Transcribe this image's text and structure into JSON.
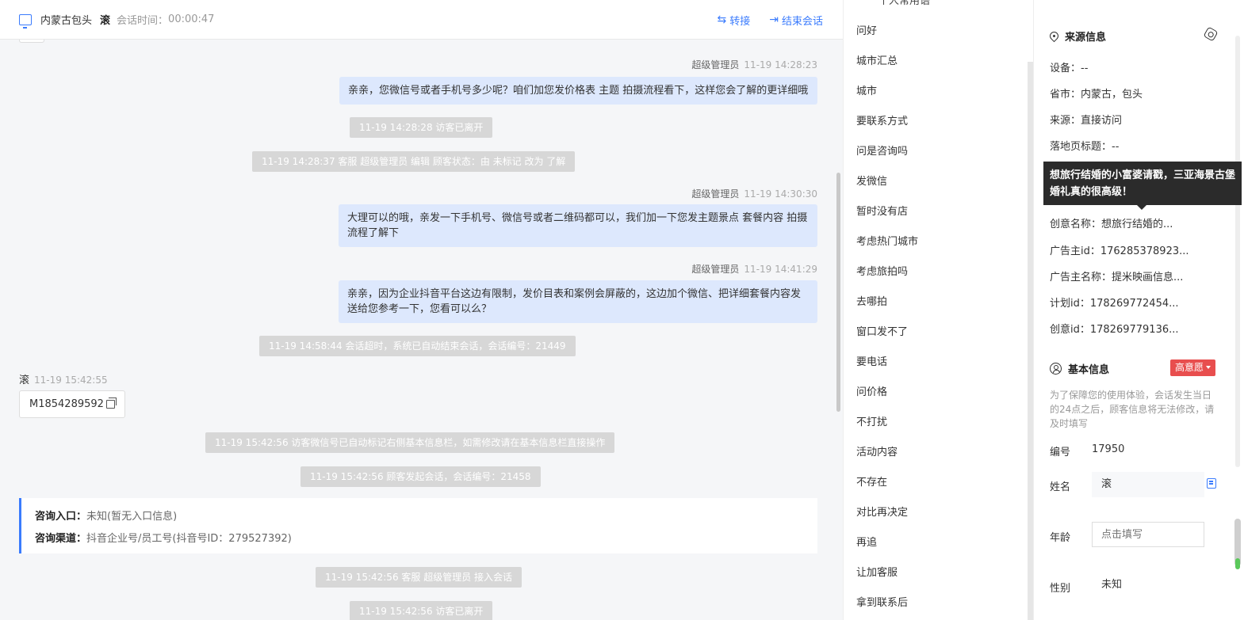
{
  "header": {
    "location": "内蒙古包头",
    "visitor_name": "滚",
    "session_time_label": "会话时间：",
    "session_time": "00:00:47",
    "transfer_label": "转接",
    "end_label": "结束会话"
  },
  "messages": {
    "m1": {
      "sender": "超级管理员",
      "time": "11-19 14:28:23",
      "text": "亲亲，您微信号或者手机号多少呢？咱们加您发价格表 主题 拍摄流程看下，这样您会了解的更详细哦"
    },
    "s1": "11-19 14:28:28 访客已离开",
    "s2": "11-19 14:28:37 客服 超级管理员 编辑 顾客状态：由 未标记 改为 了解",
    "m2": {
      "sender": "超级管理员",
      "time": "11-19 14:30:30",
      "line1": "大理可以的哦，亲发一下手机号、微信号或者二维码都可以，我们加一下您发主题景点 套餐内容 拍摄",
      "line2": "流程了解下"
    },
    "m3": {
      "sender": "超级管理员",
      "time": "11-19 14:41:29",
      "line1": "亲亲，因为企业抖音平台这边有限制，发价目表和案例会屏蔽的，这边加个微信、把详细套餐内容发",
      "line2": "送给您参考一下，您看可以么？"
    },
    "s3": "11-19 14:58:44 会话超时，系统已自动结束会话，会话编号：21449",
    "m4": {
      "sender": "滚",
      "time": "11-19 15:42:55",
      "text": "M1854289592"
    },
    "s4": "11-19 15:42:56 访客微信号已自动标记右侧基本信息栏，如需修改请在基本信息栏直接操作",
    "s5": "11-19 15:42:56 顾客发起会话，会话编号：21458",
    "entry": {
      "entry_label": "咨询入口：",
      "entry_value": "未知(暂无入口信息)",
      "channel_label": "咨询渠道：",
      "channel_value": "抖音企业号/员工号(抖音号ID：279527392)"
    },
    "s6": "11-19 15:42:56 客服 超级管理员 接入会话",
    "s7": "11-19 15:42:56 访客已离开"
  },
  "quick_replies": {
    "partial_top": "个人常用语",
    "items": [
      "问好",
      "城市汇总",
      "城市",
      "要联系方式",
      "问是咨询吗",
      "发微信",
      "暂时没有店",
      "考虑热门城市",
      "考虑旅拍吗",
      "去哪拍",
      "窗口发不了",
      "要电话",
      "问价格",
      "不打扰",
      "活动内容",
      "不存在",
      "对比再决定",
      "再追",
      "让加客服",
      "拿到联系后"
    ]
  },
  "source_info": {
    "title": "来源信息",
    "rows": {
      "device": "设备：--",
      "province": "省市：内蒙古，包头",
      "source": "来源：直接访问",
      "landing_title": "落地页标题：--",
      "creative_name": "创意名称：想旅行结婚的...",
      "advertiser_id": "广告主id：176285378923...",
      "advertiser_name": "广告主名称：提米映画信息...",
      "plan_id": "计划id：178269772454...",
      "creative_id": "创意id：178269779136..."
    },
    "tooltip": "想旅行结婚的小富婆请戳，三亚海景古堡婚礼真的很高级！"
  },
  "basic_info": {
    "title": "基本信息",
    "intent_badge": "高意愿",
    "note": "为了保障您的使用体验，会话发生当日的24点之后，顾客信息将无法修改，请及时填写",
    "id_label": "编号",
    "id_value": "17950",
    "name_label": "姓名",
    "name_value": "滚",
    "age_label": "年龄",
    "age_placeholder": "点击填写",
    "gender_label": "性别",
    "gender_value": "未知"
  },
  "colors": {
    "accent": "#3a7bfd",
    "bubble": "#dde8fd",
    "badge": "#e84e4e"
  }
}
